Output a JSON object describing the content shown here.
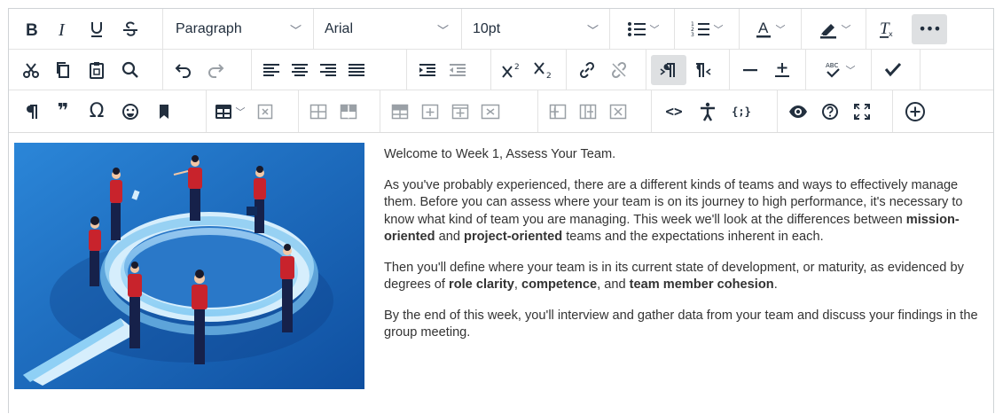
{
  "toolbar": {
    "block_format": "Paragraph",
    "font_family": "Arial",
    "font_size": "10pt",
    "more_label": "•••",
    "omega_glyph": "Ω",
    "quote_glyph": "❞",
    "code_label": "<>",
    "variable_label": "{;}"
  },
  "content": {
    "p1": "Welcome to Week 1, Assess Your Team.",
    "p2_a": "As you've probably experienced, there are a different kinds of teams and ways to effectively manage them. Before you can assess where your team is on its journey to high performance, it's necessary to know what kind of team you are managing. This week we'll look at the differences between ",
    "p2_b": "mission-oriented",
    "p2_c": " and ",
    "p2_d": "project-oriented",
    "p2_e": " teams and the expectations inherent in each.",
    "p3_a": "Then you'll define where your team is in its current state of development, or maturity, as evidenced by degrees of ",
    "p3_b": "role clarity",
    "p3_c": ", ",
    "p3_d": "competence",
    "p3_e": ", and ",
    "p3_f": "team member cohesion",
    "p3_g": ".",
    "p4": "By the end of this week, you'll interview and gather data from your team and discuss your findings in the group meeting."
  },
  "colors": {
    "icon": "#222f3e",
    "active_bg": "#dee0e2",
    "hero_bg": "#1e6fc0",
    "figure_red": "#c8232c"
  }
}
